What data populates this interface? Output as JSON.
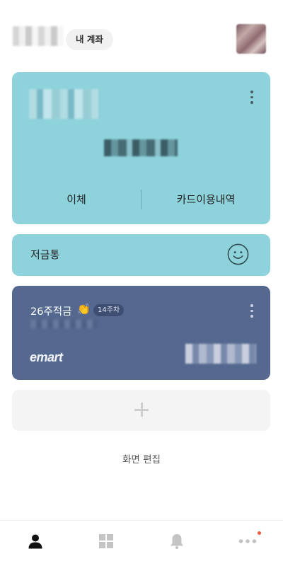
{
  "header": {
    "account_pill": "내 계좌",
    "name_icon": "blurred-name",
    "avatar_icon": "profile-photo"
  },
  "main_account": {
    "transfer_label": "이체",
    "card_history_label": "카드이용내역",
    "color": "#8ed3dc"
  },
  "savings_box": {
    "label": "저금통",
    "icon": "smile-face-icon"
  },
  "plan_card": {
    "title": "26주적금",
    "emoji": "👏",
    "week_badge": "14주차",
    "brand": "emart",
    "color": "#55688f"
  },
  "add_card": {
    "icon": "plus-icon"
  },
  "edit_label": "화면 편집",
  "bottom_nav": [
    {
      "name": "person-icon"
    },
    {
      "name": "grid-icon"
    },
    {
      "name": "bell-icon"
    },
    {
      "name": "more-icon",
      "badge_color": "#ee5a3c"
    }
  ]
}
